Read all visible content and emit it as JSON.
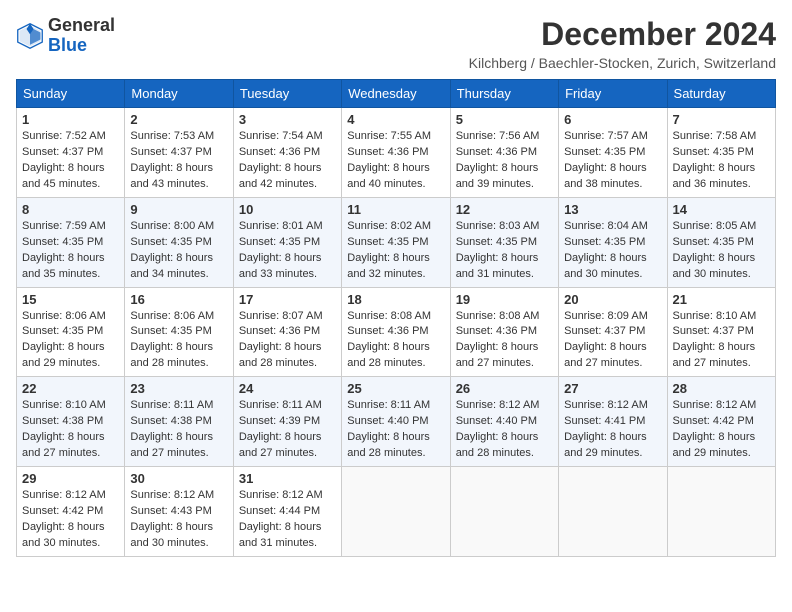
{
  "header": {
    "logo_general": "General",
    "logo_blue": "Blue",
    "month_title": "December 2024",
    "location": "Kilchberg / Baechler-Stocken, Zurich, Switzerland"
  },
  "calendar": {
    "days_of_week": [
      "Sunday",
      "Monday",
      "Tuesday",
      "Wednesday",
      "Thursday",
      "Friday",
      "Saturday"
    ],
    "weeks": [
      [
        {
          "day": "1",
          "info": "Sunrise: 7:52 AM\nSunset: 4:37 PM\nDaylight: 8 hours\nand 45 minutes."
        },
        {
          "day": "2",
          "info": "Sunrise: 7:53 AM\nSunset: 4:37 PM\nDaylight: 8 hours\nand 43 minutes."
        },
        {
          "day": "3",
          "info": "Sunrise: 7:54 AM\nSunset: 4:36 PM\nDaylight: 8 hours\nand 42 minutes."
        },
        {
          "day": "4",
          "info": "Sunrise: 7:55 AM\nSunset: 4:36 PM\nDaylight: 8 hours\nand 40 minutes."
        },
        {
          "day": "5",
          "info": "Sunrise: 7:56 AM\nSunset: 4:36 PM\nDaylight: 8 hours\nand 39 minutes."
        },
        {
          "day": "6",
          "info": "Sunrise: 7:57 AM\nSunset: 4:35 PM\nDaylight: 8 hours\nand 38 minutes."
        },
        {
          "day": "7",
          "info": "Sunrise: 7:58 AM\nSunset: 4:35 PM\nDaylight: 8 hours\nand 36 minutes."
        }
      ],
      [
        {
          "day": "8",
          "info": "Sunrise: 7:59 AM\nSunset: 4:35 PM\nDaylight: 8 hours\nand 35 minutes."
        },
        {
          "day": "9",
          "info": "Sunrise: 8:00 AM\nSunset: 4:35 PM\nDaylight: 8 hours\nand 34 minutes."
        },
        {
          "day": "10",
          "info": "Sunrise: 8:01 AM\nSunset: 4:35 PM\nDaylight: 8 hours\nand 33 minutes."
        },
        {
          "day": "11",
          "info": "Sunrise: 8:02 AM\nSunset: 4:35 PM\nDaylight: 8 hours\nand 32 minutes."
        },
        {
          "day": "12",
          "info": "Sunrise: 8:03 AM\nSunset: 4:35 PM\nDaylight: 8 hours\nand 31 minutes."
        },
        {
          "day": "13",
          "info": "Sunrise: 8:04 AM\nSunset: 4:35 PM\nDaylight: 8 hours\nand 30 minutes."
        },
        {
          "day": "14",
          "info": "Sunrise: 8:05 AM\nSunset: 4:35 PM\nDaylight: 8 hours\nand 30 minutes."
        }
      ],
      [
        {
          "day": "15",
          "info": "Sunrise: 8:06 AM\nSunset: 4:35 PM\nDaylight: 8 hours\nand 29 minutes."
        },
        {
          "day": "16",
          "info": "Sunrise: 8:06 AM\nSunset: 4:35 PM\nDaylight: 8 hours\nand 28 minutes."
        },
        {
          "day": "17",
          "info": "Sunrise: 8:07 AM\nSunset: 4:36 PM\nDaylight: 8 hours\nand 28 minutes."
        },
        {
          "day": "18",
          "info": "Sunrise: 8:08 AM\nSunset: 4:36 PM\nDaylight: 8 hours\nand 28 minutes."
        },
        {
          "day": "19",
          "info": "Sunrise: 8:08 AM\nSunset: 4:36 PM\nDaylight: 8 hours\nand 27 minutes."
        },
        {
          "day": "20",
          "info": "Sunrise: 8:09 AM\nSunset: 4:37 PM\nDaylight: 8 hours\nand 27 minutes."
        },
        {
          "day": "21",
          "info": "Sunrise: 8:10 AM\nSunset: 4:37 PM\nDaylight: 8 hours\nand 27 minutes."
        }
      ],
      [
        {
          "day": "22",
          "info": "Sunrise: 8:10 AM\nSunset: 4:38 PM\nDaylight: 8 hours\nand 27 minutes."
        },
        {
          "day": "23",
          "info": "Sunrise: 8:11 AM\nSunset: 4:38 PM\nDaylight: 8 hours\nand 27 minutes."
        },
        {
          "day": "24",
          "info": "Sunrise: 8:11 AM\nSunset: 4:39 PM\nDaylight: 8 hours\nand 27 minutes."
        },
        {
          "day": "25",
          "info": "Sunrise: 8:11 AM\nSunset: 4:40 PM\nDaylight: 8 hours\nand 28 minutes."
        },
        {
          "day": "26",
          "info": "Sunrise: 8:12 AM\nSunset: 4:40 PM\nDaylight: 8 hours\nand 28 minutes."
        },
        {
          "day": "27",
          "info": "Sunrise: 8:12 AM\nSunset: 4:41 PM\nDaylight: 8 hours\nand 29 minutes."
        },
        {
          "day": "28",
          "info": "Sunrise: 8:12 AM\nSunset: 4:42 PM\nDaylight: 8 hours\nand 29 minutes."
        }
      ],
      [
        {
          "day": "29",
          "info": "Sunrise: 8:12 AM\nSunset: 4:42 PM\nDaylight: 8 hours\nand 30 minutes."
        },
        {
          "day": "30",
          "info": "Sunrise: 8:12 AM\nSunset: 4:43 PM\nDaylight: 8 hours\nand 30 minutes."
        },
        {
          "day": "31",
          "info": "Sunrise: 8:12 AM\nSunset: 4:44 PM\nDaylight: 8 hours\nand 31 minutes."
        },
        {
          "day": "",
          "info": ""
        },
        {
          "day": "",
          "info": ""
        },
        {
          "day": "",
          "info": ""
        },
        {
          "day": "",
          "info": ""
        }
      ]
    ]
  }
}
